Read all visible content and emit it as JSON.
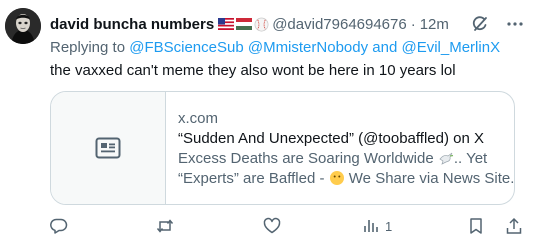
{
  "author": {
    "name": "david buncha numbers",
    "handle": "@david7964694676",
    "time": "12m",
    "flags": [
      "us-flag-icon",
      "hungary-flag-icon",
      "baseball-icon"
    ]
  },
  "reply": {
    "prefix": "Replying to ",
    "mention1": "@FBScienceSub",
    "mention2": "@MmisterNobody",
    "and": " and ",
    "mention3": "@Evil_MerlinX"
  },
  "text": "the vaxxed can't meme they also wont be here in 10 years lol",
  "card": {
    "domain": "x.com",
    "title": "“Sudden And Unexpected” (@toobaffled) on X",
    "desc_line1": "Excess Deaths are Soaring Worldwide",
    "desc_line1_end": ".. Yet",
    "desc_line2_start": "“Experts” are Baffled -",
    "desc_line2_end": "We Share via News Site...",
    "icons": [
      "article-icon",
      "dove-emoji-icon",
      "neutral-face-emoji-icon"
    ]
  },
  "actions": {
    "views_count": "1",
    "icons": [
      "reply-icon",
      "retweet-icon",
      "like-icon",
      "views-icon",
      "bookmark-icon",
      "share-icon"
    ]
  },
  "colors": {
    "link": "#1d9bf0",
    "secondary": "#536471",
    "primary": "#0f1419",
    "border": "#cfd9de"
  }
}
